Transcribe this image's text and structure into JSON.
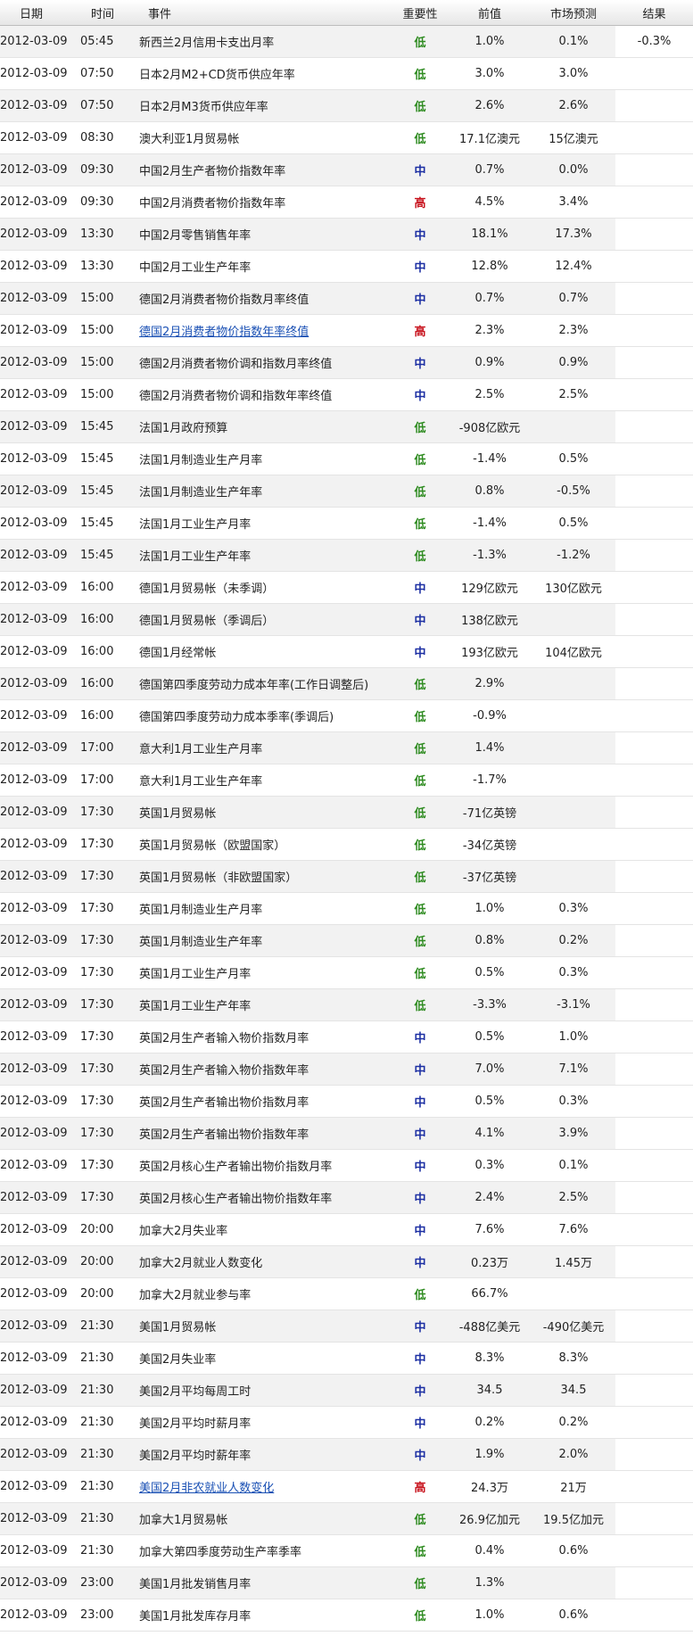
{
  "headers": {
    "date": "日期",
    "time": "时间",
    "event": "事件",
    "importance": "重要性",
    "previous": "前值",
    "forecast": "市场预测",
    "result": "结果"
  },
  "rows": [
    {
      "date": "2012-03-09",
      "time": "05:45",
      "event": "新西兰2月信用卡支出月率",
      "importance": "低",
      "level": "low",
      "previous": "1.0%",
      "forecast": "0.1%",
      "result": "-0.3%"
    },
    {
      "date": "2012-03-09",
      "time": "07:50",
      "event": "日本2月M2+CD货币供应年率",
      "importance": "低",
      "level": "low",
      "previous": "3.0%",
      "forecast": "3.0%",
      "result": ""
    },
    {
      "date": "2012-03-09",
      "time": "07:50",
      "event": "日本2月M3货币供应年率",
      "importance": "低",
      "level": "low",
      "previous": "2.6%",
      "forecast": "2.6%",
      "result": ""
    },
    {
      "date": "2012-03-09",
      "time": "08:30",
      "event": "澳大利亚1月贸易帐",
      "importance": "低",
      "level": "low",
      "previous": "17.1亿澳元",
      "forecast": "15亿澳元",
      "result": ""
    },
    {
      "date": "2012-03-09",
      "time": "09:30",
      "event": "中国2月生产者物价指数年率",
      "importance": "中",
      "level": "mid",
      "previous": "0.7%",
      "forecast": "0.0%",
      "result": ""
    },
    {
      "date": "2012-03-09",
      "time": "09:30",
      "event": "中国2月消费者物价指数年率",
      "importance": "高",
      "level": "high",
      "previous": "4.5%",
      "forecast": "3.4%",
      "result": ""
    },
    {
      "date": "2012-03-09",
      "time": "13:30",
      "event": "中国2月零售销售年率",
      "importance": "中",
      "level": "mid",
      "previous": "18.1%",
      "forecast": "17.3%",
      "result": ""
    },
    {
      "date": "2012-03-09",
      "time": "13:30",
      "event": "中国2月工业生产年率",
      "importance": "中",
      "level": "mid",
      "previous": "12.8%",
      "forecast": "12.4%",
      "result": ""
    },
    {
      "date": "2012-03-09",
      "time": "15:00",
      "event": "德国2月消费者物价指数月率终值",
      "importance": "中",
      "level": "mid",
      "previous": "0.7%",
      "forecast": "0.7%",
      "result": ""
    },
    {
      "date": "2012-03-09",
      "time": "15:00",
      "event": "德国2月消费者物价指数年率终值",
      "importance": "高",
      "level": "high",
      "previous": "2.3%",
      "forecast": "2.3%",
      "result": "",
      "link": true
    },
    {
      "date": "2012-03-09",
      "time": "15:00",
      "event": "德国2月消费者物价调和指数月率终值",
      "importance": "中",
      "level": "mid",
      "previous": "0.9%",
      "forecast": "0.9%",
      "result": ""
    },
    {
      "date": "2012-03-09",
      "time": "15:00",
      "event": "德国2月消费者物价调和指数年率终值",
      "importance": "中",
      "level": "mid",
      "previous": "2.5%",
      "forecast": "2.5%",
      "result": ""
    },
    {
      "date": "2012-03-09",
      "time": "15:45",
      "event": "法国1月政府预算",
      "importance": "低",
      "level": "low",
      "previous": "-908亿欧元",
      "forecast": "",
      "result": ""
    },
    {
      "date": "2012-03-09",
      "time": "15:45",
      "event": "法国1月制造业生产月率",
      "importance": "低",
      "level": "low",
      "previous": "-1.4%",
      "forecast": "0.5%",
      "result": ""
    },
    {
      "date": "2012-03-09",
      "time": "15:45",
      "event": "法国1月制造业生产年率",
      "importance": "低",
      "level": "low",
      "previous": "0.8%",
      "forecast": "-0.5%",
      "result": ""
    },
    {
      "date": "2012-03-09",
      "time": "15:45",
      "event": "法国1月工业生产月率",
      "importance": "低",
      "level": "low",
      "previous": "-1.4%",
      "forecast": "0.5%",
      "result": ""
    },
    {
      "date": "2012-03-09",
      "time": "15:45",
      "event": "法国1月工业生产年率",
      "importance": "低",
      "level": "low",
      "previous": "-1.3%",
      "forecast": "-1.2%",
      "result": ""
    },
    {
      "date": "2012-03-09",
      "time": "16:00",
      "event": "德国1月贸易帐（未季调）",
      "importance": "中",
      "level": "mid",
      "previous": "129亿欧元",
      "forecast": "130亿欧元",
      "result": ""
    },
    {
      "date": "2012-03-09",
      "time": "16:00",
      "event": "德国1月贸易帐（季调后）",
      "importance": "中",
      "level": "mid",
      "previous": "138亿欧元",
      "forecast": "",
      "result": ""
    },
    {
      "date": "2012-03-09",
      "time": "16:00",
      "event": "德国1月经常帐",
      "importance": "中",
      "level": "mid",
      "previous": "193亿欧元",
      "forecast": "104亿欧元",
      "result": ""
    },
    {
      "date": "2012-03-09",
      "time": "16:00",
      "event": "德国第四季度劳动力成本年率(工作日调整后)",
      "importance": "低",
      "level": "low",
      "previous": "2.9%",
      "forecast": "",
      "result": ""
    },
    {
      "date": "2012-03-09",
      "time": "16:00",
      "event": "德国第四季度劳动力成本季率(季调后)",
      "importance": "低",
      "level": "low",
      "previous": "-0.9%",
      "forecast": "",
      "result": ""
    },
    {
      "date": "2012-03-09",
      "time": "17:00",
      "event": "意大利1月工业生产月率",
      "importance": "低",
      "level": "low",
      "previous": "1.4%",
      "forecast": "",
      "result": ""
    },
    {
      "date": "2012-03-09",
      "time": "17:00",
      "event": "意大利1月工业生产年率",
      "importance": "低",
      "level": "low",
      "previous": "-1.7%",
      "forecast": "",
      "result": ""
    },
    {
      "date": "2012-03-09",
      "time": "17:30",
      "event": "英国1月贸易帐",
      "importance": "低",
      "level": "low",
      "previous": "-71亿英镑",
      "forecast": "",
      "result": ""
    },
    {
      "date": "2012-03-09",
      "time": "17:30",
      "event": "英国1月贸易帐（欧盟国家）",
      "importance": "低",
      "level": "low",
      "previous": "-34亿英镑",
      "forecast": "",
      "result": ""
    },
    {
      "date": "2012-03-09",
      "time": "17:30",
      "event": "英国1月贸易帐（非欧盟国家）",
      "importance": "低",
      "level": "low",
      "previous": "-37亿英镑",
      "forecast": "",
      "result": ""
    },
    {
      "date": "2012-03-09",
      "time": "17:30",
      "event": "英国1月制造业生产月率",
      "importance": "低",
      "level": "low",
      "previous": "1.0%",
      "forecast": "0.3%",
      "result": ""
    },
    {
      "date": "2012-03-09",
      "time": "17:30",
      "event": "英国1月制造业生产年率",
      "importance": "低",
      "level": "low",
      "previous": "0.8%",
      "forecast": "0.2%",
      "result": ""
    },
    {
      "date": "2012-03-09",
      "time": "17:30",
      "event": "英国1月工业生产月率",
      "importance": "低",
      "level": "low",
      "previous": "0.5%",
      "forecast": "0.3%",
      "result": ""
    },
    {
      "date": "2012-03-09",
      "time": "17:30",
      "event": "英国1月工业生产年率",
      "importance": "低",
      "level": "low",
      "previous": "-3.3%",
      "forecast": "-3.1%",
      "result": ""
    },
    {
      "date": "2012-03-09",
      "time": "17:30",
      "event": "英国2月生产者输入物价指数月率",
      "importance": "中",
      "level": "mid",
      "previous": "0.5%",
      "forecast": "1.0%",
      "result": ""
    },
    {
      "date": "2012-03-09",
      "time": "17:30",
      "event": "英国2月生产者输入物价指数年率",
      "importance": "中",
      "level": "mid",
      "previous": "7.0%",
      "forecast": "7.1%",
      "result": ""
    },
    {
      "date": "2012-03-09",
      "time": "17:30",
      "event": "英国2月生产者输出物价指数月率",
      "importance": "中",
      "level": "mid",
      "previous": "0.5%",
      "forecast": "0.3%",
      "result": ""
    },
    {
      "date": "2012-03-09",
      "time": "17:30",
      "event": "英国2月生产者输出物价指数年率",
      "importance": "中",
      "level": "mid",
      "previous": "4.1%",
      "forecast": "3.9%",
      "result": ""
    },
    {
      "date": "2012-03-09",
      "time": "17:30",
      "event": "英国2月核心生产者输出物价指数月率",
      "importance": "中",
      "level": "mid",
      "previous": "0.3%",
      "forecast": "0.1%",
      "result": ""
    },
    {
      "date": "2012-03-09",
      "time": "17:30",
      "event": "英国2月核心生产者输出物价指数年率",
      "importance": "中",
      "level": "mid",
      "previous": "2.4%",
      "forecast": "2.5%",
      "result": ""
    },
    {
      "date": "2012-03-09",
      "time": "20:00",
      "event": "加拿大2月失业率",
      "importance": "中",
      "level": "mid",
      "previous": "7.6%",
      "forecast": "7.6%",
      "result": ""
    },
    {
      "date": "2012-03-09",
      "time": "20:00",
      "event": "加拿大2月就业人数变化",
      "importance": "中",
      "level": "mid",
      "previous": "0.23万",
      "forecast": "1.45万",
      "result": ""
    },
    {
      "date": "2012-03-09",
      "time": "20:00",
      "event": "加拿大2月就业参与率",
      "importance": "低",
      "level": "low",
      "previous": "66.7%",
      "forecast": "",
      "result": ""
    },
    {
      "date": "2012-03-09",
      "time": "21:30",
      "event": "美国1月贸易帐",
      "importance": "中",
      "level": "mid",
      "previous": "-488亿美元",
      "forecast": "-490亿美元",
      "result": ""
    },
    {
      "date": "2012-03-09",
      "time": "21:30",
      "event": "美国2月失业率",
      "importance": "中",
      "level": "mid",
      "previous": "8.3%",
      "forecast": "8.3%",
      "result": ""
    },
    {
      "date": "2012-03-09",
      "time": "21:30",
      "event": "美国2月平均每周工时",
      "importance": "中",
      "level": "mid",
      "previous": "34.5",
      "forecast": "34.5",
      "result": ""
    },
    {
      "date": "2012-03-09",
      "time": "21:30",
      "event": "美国2月平均时薪月率",
      "importance": "中",
      "level": "mid",
      "previous": "0.2%",
      "forecast": "0.2%",
      "result": ""
    },
    {
      "date": "2012-03-09",
      "time": "21:30",
      "event": "美国2月平均时薪年率",
      "importance": "中",
      "level": "mid",
      "previous": "1.9%",
      "forecast": "2.0%",
      "result": ""
    },
    {
      "date": "2012-03-09",
      "time": "21:30",
      "event": "美国2月非农就业人数变化",
      "importance": "高",
      "level": "high",
      "previous": "24.3万",
      "forecast": "21万",
      "result": "",
      "link": true
    },
    {
      "date": "2012-03-09",
      "time": "21:30",
      "event": "加拿大1月贸易帐",
      "importance": "低",
      "level": "low",
      "previous": "26.9亿加元",
      "forecast": "19.5亿加元",
      "result": ""
    },
    {
      "date": "2012-03-09",
      "time": "21:30",
      "event": "加拿大第四季度劳动生产率季率",
      "importance": "低",
      "level": "low",
      "previous": "0.4%",
      "forecast": "0.6%",
      "result": ""
    },
    {
      "date": "2012-03-09",
      "time": "23:00",
      "event": "美国1月批发销售月率",
      "importance": "低",
      "level": "low",
      "previous": "1.3%",
      "forecast": "",
      "result": ""
    },
    {
      "date": "2012-03-09",
      "time": "23:00",
      "event": "美国1月批发库存月率",
      "importance": "低",
      "level": "low",
      "previous": "1.0%",
      "forecast": "0.6%",
      "result": ""
    }
  ]
}
